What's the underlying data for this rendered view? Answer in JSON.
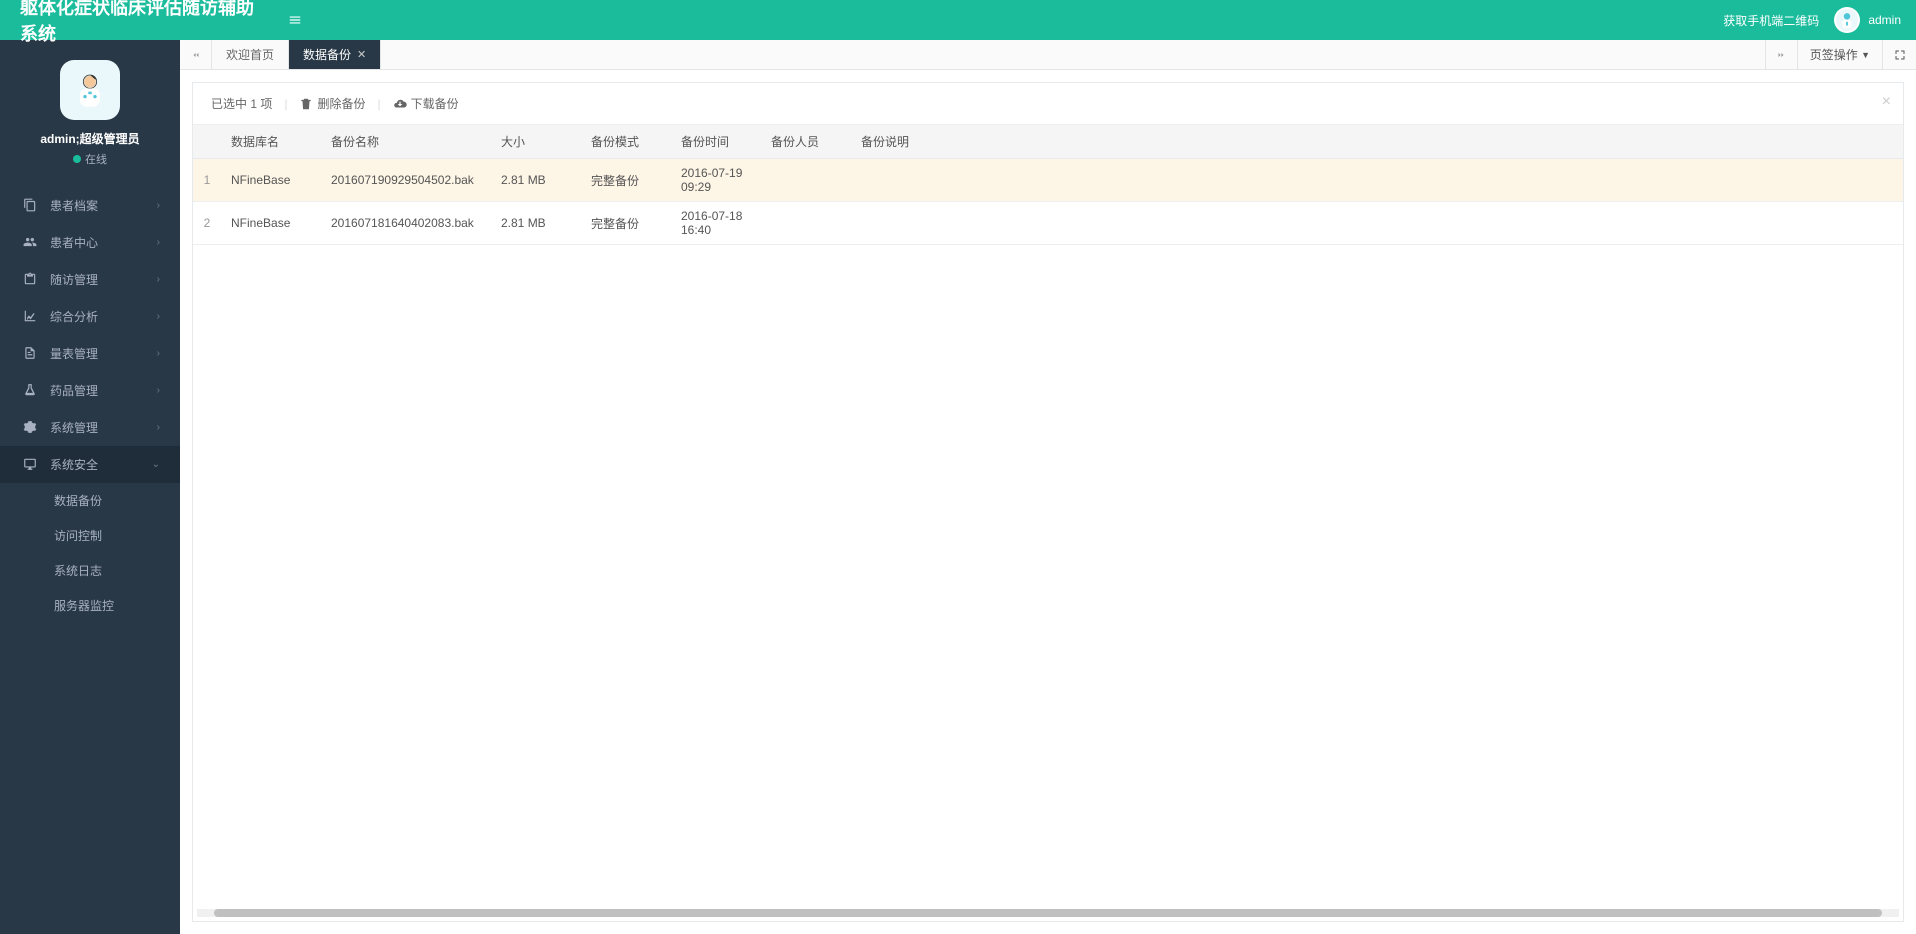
{
  "header": {
    "title": "躯体化症状临床评估随访辅助系统",
    "qr_link": "获取手机端二维码",
    "username": "admin"
  },
  "user": {
    "name": "admin;超级管理员",
    "status": "在线"
  },
  "sidebar": {
    "items": [
      {
        "icon": "file",
        "label": "患者档案"
      },
      {
        "icon": "users",
        "label": "患者中心"
      },
      {
        "icon": "clipboard",
        "label": "随访管理"
      },
      {
        "icon": "chart",
        "label": "综合分析"
      },
      {
        "icon": "list",
        "label": "量表管理"
      },
      {
        "icon": "flask",
        "label": "药品管理"
      },
      {
        "icon": "cogs",
        "label": "系统管理"
      },
      {
        "icon": "monitor",
        "label": "系统安全"
      }
    ],
    "subitems": [
      {
        "label": "数据备份"
      },
      {
        "label": "访问控制"
      },
      {
        "label": "系统日志"
      },
      {
        "label": "服务器监控"
      }
    ]
  },
  "tabs": {
    "home": "欢迎首页",
    "active": "数据备份",
    "ops": "页签操作"
  },
  "toolbar": {
    "selected": "已选中 1 项",
    "delete": "删除备份",
    "download": "下载备份"
  },
  "table": {
    "headers": {
      "dbname": "数据库名",
      "filename": "备份名称",
      "size": "大小",
      "mode": "备份模式",
      "time": "备份时间",
      "person": "备份人员",
      "desc": "备份说明"
    },
    "rows": [
      {
        "idx": "1",
        "dbname": "NFineBase",
        "filename": "201607190929504502.bak",
        "size": "2.81 MB",
        "mode": "完整备份",
        "time": "2016-07-19 09:29",
        "person": "",
        "desc": ""
      },
      {
        "idx": "2",
        "dbname": "NFineBase",
        "filename": "201607181640402083.bak",
        "size": "2.81 MB",
        "mode": "完整备份",
        "time": "2016-07-18 16:40",
        "person": "",
        "desc": ""
      }
    ]
  }
}
